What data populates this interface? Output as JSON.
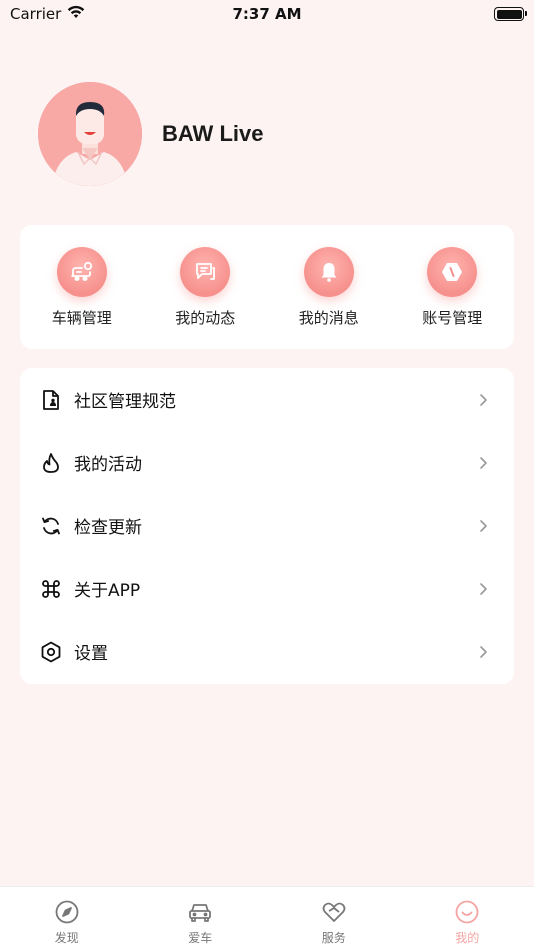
{
  "status_bar": {
    "carrier": "Carrier",
    "time": "7:37 AM"
  },
  "profile": {
    "username": "BAW Live"
  },
  "quick_actions": [
    {
      "label": "车辆管理",
      "icon": "car-service-icon"
    },
    {
      "label": "我的动态",
      "icon": "chat-icon"
    },
    {
      "label": "我的消息",
      "icon": "bell-icon"
    },
    {
      "label": "账号管理",
      "icon": "account-icon"
    }
  ],
  "menu": [
    {
      "label": "社区管理规范",
      "icon": "document-icon"
    },
    {
      "label": "我的活动",
      "icon": "flame-icon"
    },
    {
      "label": "检查更新",
      "icon": "refresh-icon"
    },
    {
      "label": "关于APP",
      "icon": "command-icon"
    },
    {
      "label": "设置",
      "icon": "settings-icon"
    }
  ],
  "tabs": [
    {
      "label": "发现",
      "icon": "compass-icon",
      "active": false
    },
    {
      "label": "爱车",
      "icon": "car-icon",
      "active": false
    },
    {
      "label": "服务",
      "icon": "heart-service-icon",
      "active": false
    },
    {
      "label": "我的",
      "icon": "smile-icon",
      "active": true
    }
  ],
  "colors": {
    "background": "#fdf3f2",
    "accent": "#f4a4a2",
    "icon_gradient": "#f6908c"
  }
}
